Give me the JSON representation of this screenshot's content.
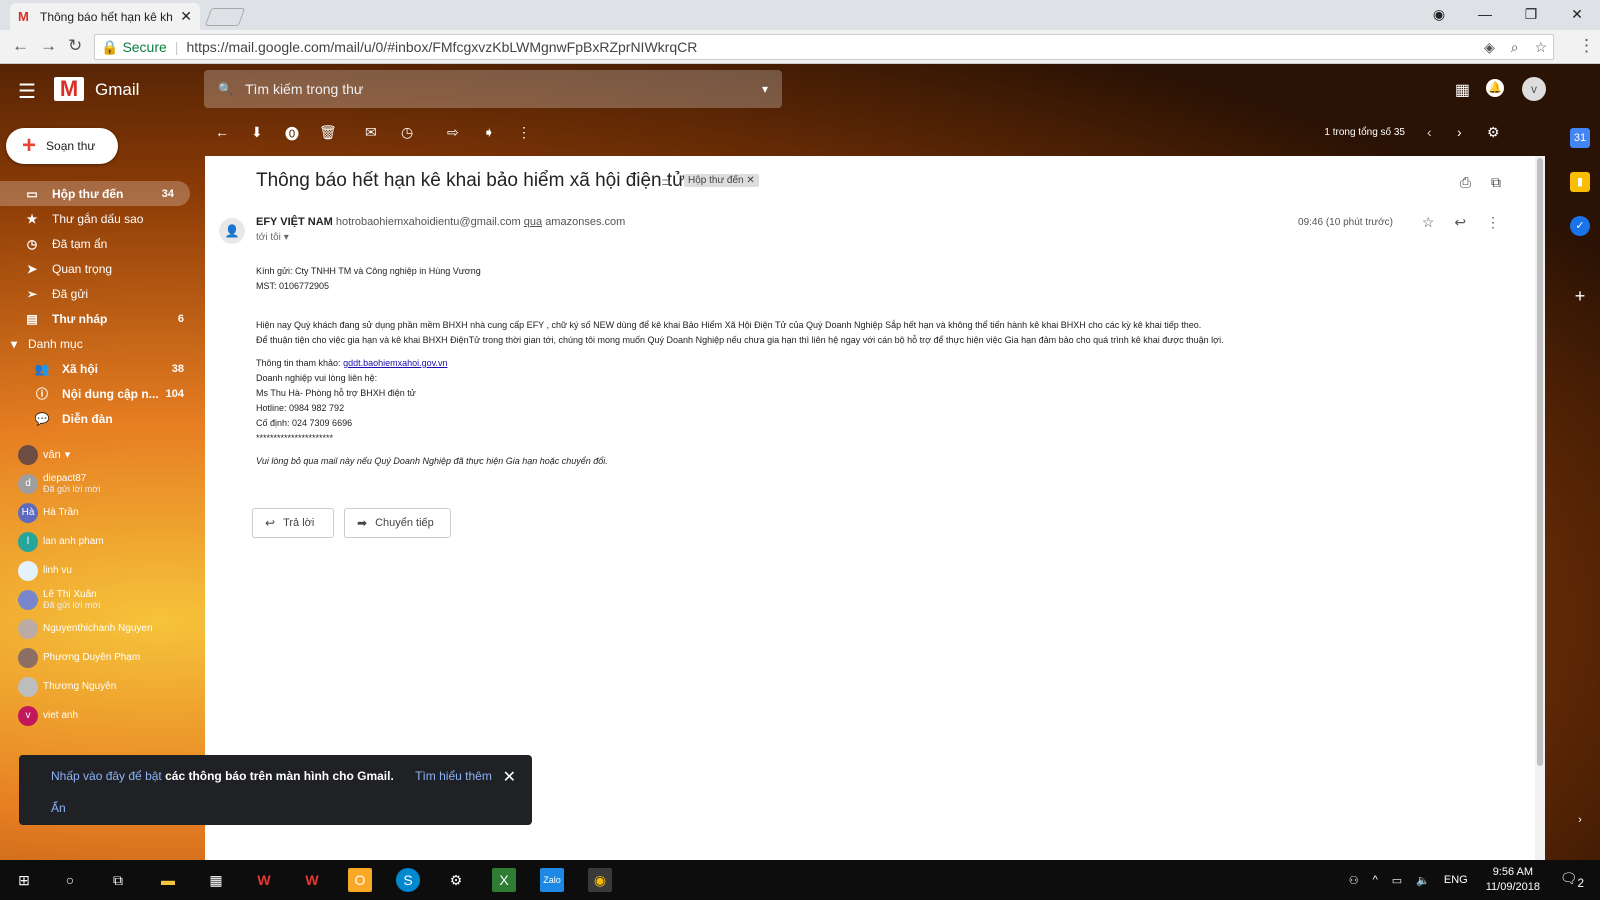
{
  "browser": {
    "tab_title": "Thông báo hết hạn kê kh",
    "secure_label": "Secure",
    "url": "https://mail.google.com/mail/u/0/#inbox/FMfcgxvzKbLWMgnwFpBxRZprNIWkrqCR"
  },
  "gmail": {
    "app_name": "Gmail",
    "search_placeholder": "Tìm kiếm trong thư",
    "compose_label": "Soạn thư",
    "nav": [
      {
        "icon": "inbox-icon",
        "label": "Hộp thư đến",
        "count": "34"
      },
      {
        "icon": "star-icon",
        "label": "Thư gắn dấu sao",
        "count": ""
      },
      {
        "icon": "clock-icon",
        "label": "Đã tạm ẩn",
        "count": ""
      },
      {
        "icon": "important-icon",
        "label": "Quan trọng",
        "count": ""
      },
      {
        "icon": "send-icon",
        "label": "Đã gửi",
        "count": ""
      },
      {
        "icon": "draft-icon",
        "label": "Thư nháp",
        "count": "6"
      },
      {
        "icon": "label-icon",
        "label": "Danh mục",
        "count": ""
      },
      {
        "icon": "people-icon",
        "label": "Xã hội",
        "count": "38"
      },
      {
        "icon": "info-icon",
        "label": "Nội dung cập n...",
        "count": "104"
      },
      {
        "icon": "forum-icon",
        "label": "Diễn đàn",
        "count": ""
      }
    ],
    "hangouts_user": "vân",
    "contacts": [
      {
        "initial": "d",
        "name": "diepact87",
        "status": "Đã gửi lời mời",
        "color": "#9e9e9e"
      },
      {
        "initial": "Hà",
        "name": "Hà Trần",
        "status": "",
        "color": "#5c6bc0"
      },
      {
        "initial": "l",
        "name": "lan anh pham",
        "status": "",
        "color": "#26a69a"
      },
      {
        "initial": "",
        "name": "linh vu",
        "status": "",
        "color": "#e3f2fd"
      },
      {
        "initial": "",
        "name": "Lê Thị Xuân",
        "status": "Đã gửi lời mời",
        "color": "#7986cb"
      },
      {
        "initial": "",
        "name": "Nguyenthichanh Nguyen",
        "status": "",
        "color": "#bcaaa4"
      },
      {
        "initial": "",
        "name": "Phương Duyên Phạm",
        "status": "",
        "color": "#8d6e63"
      },
      {
        "initial": "",
        "name": "Thương Nguyễn",
        "status": "",
        "color": "#bdbdbd"
      },
      {
        "initial": "v",
        "name": "viet anh",
        "status": "",
        "color": "#c2185b"
      }
    ],
    "snackbar": {
      "link1": "Nhấp vào đây để bật",
      "text": "các thông báo trên màn hình cho Gmail.",
      "learn_more": "Tìm hiểu thêm",
      "hide": "Ẩn"
    },
    "pager": "1 trong tổng số 35"
  },
  "message": {
    "subject": "Thông báo hết hạn kê khai bảo hiểm xã hội điện tử",
    "label": "Hộp thư đến",
    "sender_name": "EFY VIỆT NAM",
    "sender_email": "hotrobaohiemxahoidientu@gmail.com",
    "via_word": "qua",
    "via_domain": "amazonses.com",
    "to": "tới tôi",
    "time": "09:46 (10 phút trước)",
    "body": {
      "l1": "Kính gửi: Cty TNHH TM và Công nghiệp in Hùng Vương",
      "l2": "MST: 0106772905",
      "l3": "Hiện nay Quý khách đang sử dụng phần mềm BHXH nhà cung cấp EFY , chữ ký số NEW dùng để kê khai Bảo Hiểm Xã Hội Điện Tử của Quý Doanh Nghiệp Sắp hết hạn và không thể tiến hành kê khai BHXH cho các kỳ kê khai tiếp theo.",
      "l4": "Để thuận tiện cho việc gia hạn và kê khai BHXH ĐiệnTử trong thời gian tới, chúng tôi mong muốn Quý Doanh Nghiệp nếu chưa gia hạn thì liên hệ ngay với cán bộ hỗ trợ để thực hiện việc Gia hạn đảm bảo cho quá trình kê khai được thuận lợi.",
      "l5_prefix": "Thông tin tham khảo:",
      "l5_link": "gddt.baohiemxahoi.gov.vn",
      "l6": "Doanh nghiệp vui lòng liên hệ:",
      "l7": "Ms Thu Hà- Phòng hỗ trợ BHXH điện tử",
      "l8": "Hotline: 0984 982 792",
      "l9": "Cố định: 024 7309 6696",
      "l10": "**********************",
      "l11": "Vui lòng bỏ qua mail này nếu Quý Doanh Nghiệp đã thực hiện Gia hạn hoặc chuyển đổi."
    },
    "reply_label": "Trả lời",
    "forward_label": "Chuyển tiếp"
  },
  "taskbar": {
    "lang": "ENG",
    "time": "9:56 AM",
    "date": "11/09/2018",
    "notif_count": "2"
  }
}
